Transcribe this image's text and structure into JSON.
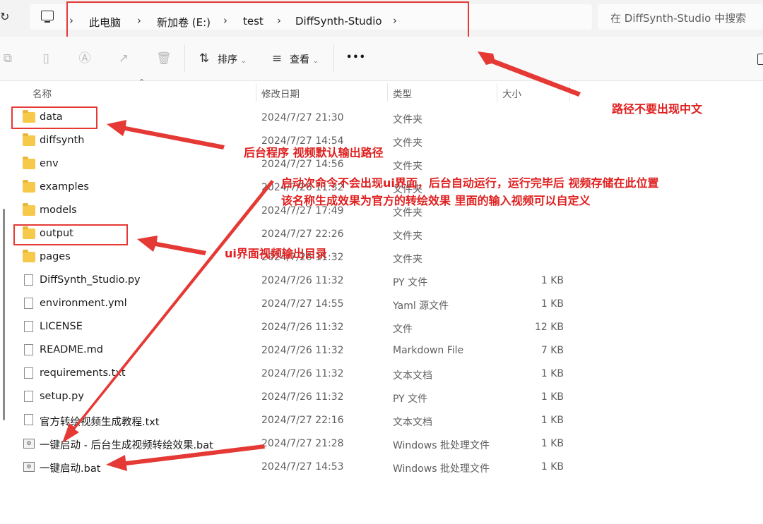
{
  "address": {
    "crumbs": [
      "此电脑",
      "新加卷 (E:)",
      "test",
      "DiffSynth-Studio"
    ],
    "search_placeholder": "在 DiffSynth-Studio 中搜索"
  },
  "toolbar": {
    "sort_label": "排序",
    "view_label": "查看",
    "more_label": "•••"
  },
  "columns": {
    "name": "名称",
    "date": "修改日期",
    "type": "类型",
    "size": "大小"
  },
  "files": [
    {
      "name": "data",
      "date": "2024/7/27 21:30",
      "type": "文件夹",
      "size": "",
      "kind": "folder"
    },
    {
      "name": "diffsynth",
      "date": "2024/7/27 14:54",
      "type": "文件夹",
      "size": "",
      "kind": "folder"
    },
    {
      "name": "env",
      "date": "2024/7/27 14:56",
      "type": "文件夹",
      "size": "",
      "kind": "folder"
    },
    {
      "name": "examples",
      "date": "2024/7/26 11:32",
      "type": "文件夹",
      "size": "",
      "kind": "folder"
    },
    {
      "name": "models",
      "date": "2024/7/27 17:49",
      "type": "文件夹",
      "size": "",
      "kind": "folder"
    },
    {
      "name": "output",
      "date": "2024/7/27 22:26",
      "type": "文件夹",
      "size": "",
      "kind": "folder"
    },
    {
      "name": "pages",
      "date": "2024/7/26 11:32",
      "type": "文件夹",
      "size": "",
      "kind": "folder"
    },
    {
      "name": "DiffSynth_Studio.py",
      "date": "2024/7/26 11:32",
      "type": "PY 文件",
      "size": "1 KB",
      "kind": "file"
    },
    {
      "name": "environment.yml",
      "date": "2024/7/27 14:55",
      "type": "Yaml 源文件",
      "size": "1 KB",
      "kind": "file"
    },
    {
      "name": "LICENSE",
      "date": "2024/7/26 11:32",
      "type": "文件",
      "size": "12 KB",
      "kind": "file"
    },
    {
      "name": "README.md",
      "date": "2024/7/26 11:32",
      "type": "Markdown File",
      "size": "7 KB",
      "kind": "file"
    },
    {
      "name": "requirements.txt",
      "date": "2024/7/26 11:32",
      "type": "文本文档",
      "size": "1 KB",
      "kind": "file"
    },
    {
      "name": "setup.py",
      "date": "2024/7/26 11:32",
      "type": "PY 文件",
      "size": "1 KB",
      "kind": "file"
    },
    {
      "name": "官方转绘视频生成教程.txt",
      "date": "2024/7/27 22:16",
      "type": "文本文档",
      "size": "1 KB",
      "kind": "file"
    },
    {
      "name": "一键启动 - 后台生成视频转绘效果.bat",
      "date": "2024/7/27 21:28",
      "type": "Windows 批处理文件",
      "size": "1 KB",
      "kind": "bat"
    },
    {
      "name": "一键启动.bat",
      "date": "2024/7/27 14:53",
      "type": "Windows 批处理文件",
      "size": "1 KB",
      "kind": "bat"
    }
  ],
  "annotations": {
    "path_note": "路径不要出现中文",
    "data_note": "后台程序 视频默认输出路径",
    "bat_note_line1": "启动次命令不会出现ui界面，后台自动运行，运行完毕后 视频存储在此位置",
    "bat_note_line2": "该名称生成效果为官方的转绘效果 里面的输入视频可以自定义",
    "output_note": "ui界面视频输出目录"
  },
  "colors": {
    "annotation_red": "#e02020",
    "folder_yellow": "#f6c94b"
  }
}
